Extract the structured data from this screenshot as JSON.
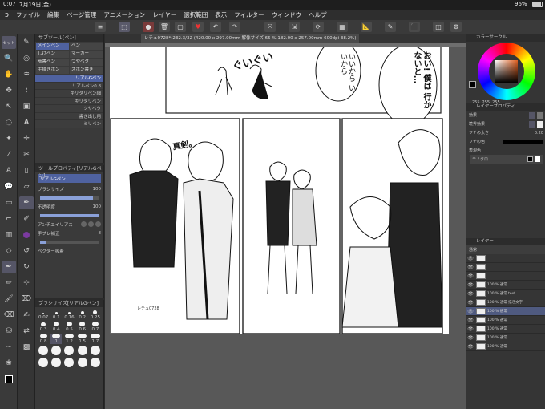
{
  "status": {
    "time": "0:07",
    "date": "7月19日(金)",
    "battery": "96%"
  },
  "menu": [
    "ファイル",
    "編集",
    "ページ管理",
    "アニメーション",
    "レイヤー",
    "選択範囲",
    "表示",
    "フィルター",
    "ウィンドウ",
    "ヘルプ"
  ],
  "doc_tab": "レチュ0728*(232.3/32 (420.00 x 297.00mm 解像サイズ 65 % 182.00 x 257.00mm 600dpi 38.2%)",
  "left_tabs": {
    "top": "セット"
  },
  "subtool": {
    "title": "サブツール[ペン]",
    "items": [
      "メインペン",
      "ペン",
      "しげペン",
      "マーカー",
      "筋書ペン",
      "つやベタ",
      "手描きポン",
      "ズボン書き"
    ],
    "brushes": [
      "リアルGペン",
      "リアルペン0.8",
      "キリタリペン細",
      "キリタリペン",
      "ツヤベタ",
      "書き出し用",
      "ミリペン"
    ]
  },
  "toolprop": {
    "title": "ツールプロパティ[リアルGペン]",
    "name": "リアルGペン",
    "rows": [
      {
        "label": "ブラシサイズ",
        "value": "100"
      },
      {
        "label": "不透明度",
        "value": "100"
      },
      {
        "label": "アンチエイリアス",
        "value": ""
      },
      {
        "label": "手ブレ補正",
        "value": "8"
      },
      {
        "label": "ベクター吸着",
        "value": ""
      }
    ]
  },
  "brushsize": {
    "title": "ブラシサイズ[リアルGペン]",
    "values": [
      "0.07",
      "0.1",
      "0.16",
      "0.2",
      "0.25",
      "0.3",
      "0.4",
      "0.5",
      "0.6",
      "0.7",
      "0.8",
      "1",
      "1.2",
      "1.5",
      "1.7",
      "",
      "",
      "",
      "",
      "",
      "",
      "",
      "",
      "",
      ""
    ],
    "selected": "1"
  },
  "color": {
    "title": "カラーサークル",
    "h": "255",
    "s": "255",
    "v": "255"
  },
  "layerprop": {
    "title": "レイヤープロパティ",
    "effect": "効果",
    "border_effect": "境界効果",
    "border_width": "フチの太さ",
    "border_width_value": "0.20",
    "border_color": "フチの色",
    "mode": "表現色",
    "mode_value": "モノクロ"
  },
  "layers": {
    "title": "レイヤー",
    "blend": "通常",
    "items": [
      {
        "name": "",
        "pct": ""
      },
      {
        "name": "",
        "pct": ""
      },
      {
        "name": "",
        "pct": ""
      },
      {
        "name": "100 %",
        "pct": "通常"
      },
      {
        "name": "100 % 通常 text",
        "pct": ""
      },
      {
        "name": "100 % 通常 描き文字",
        "pct": ""
      },
      {
        "name": "100 % 通常",
        "pct": ""
      },
      {
        "name": "100 % 通常",
        "pct": ""
      },
      {
        "name": "100 % 通常",
        "pct": ""
      },
      {
        "name": "100 % 通常",
        "pct": ""
      },
      {
        "name": "100 % 通常",
        "pct": ""
      }
    ]
  },
  "manga": {
    "sfx1": "ぐいぐい",
    "bubble1": "いいから いいから",
    "bubble2": "おい! 僕は 行かないと…",
    "sfx2": "真剣。",
    "label": "レチュ0728"
  },
  "colors": {
    "accent": "#4f62a0",
    "panel": "#353535"
  }
}
